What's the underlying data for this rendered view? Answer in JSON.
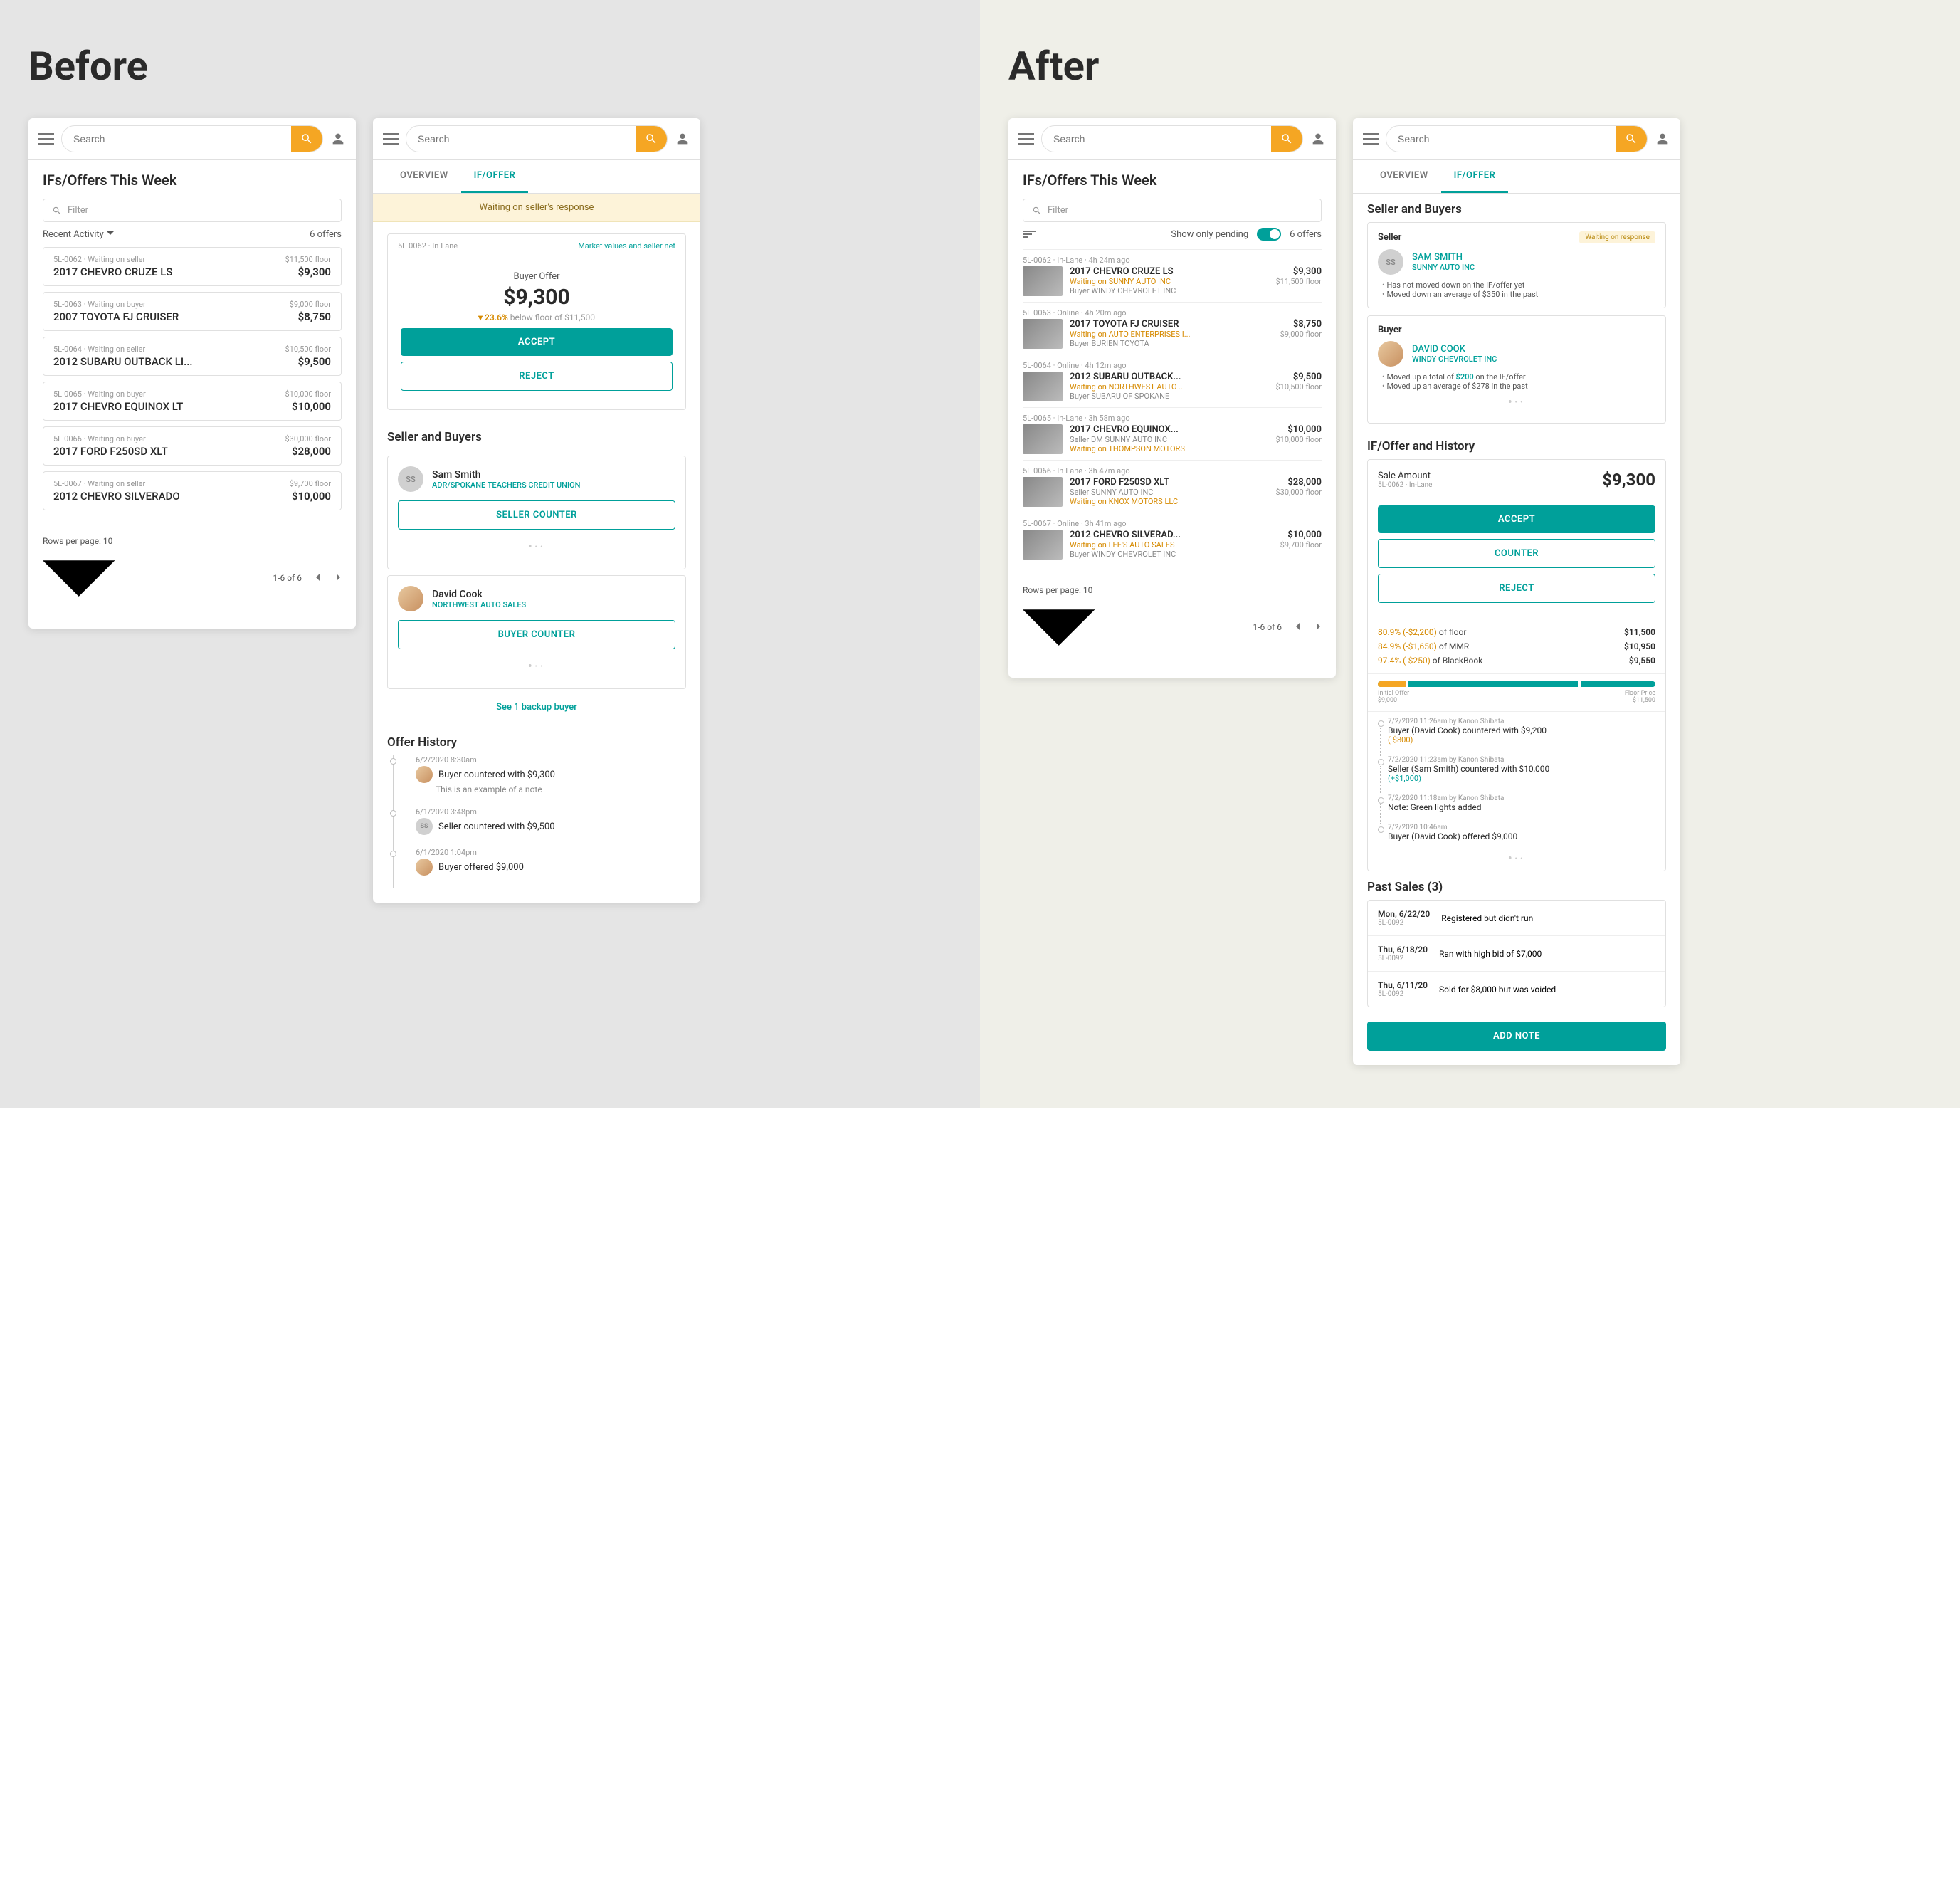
{
  "labels": {
    "before": "Before",
    "after": "After",
    "search_ph": "Search",
    "page_title": "IFs/Offers This Week",
    "filter_ph": "Filter",
    "recent_activity": "Recent Activity",
    "offers_count": "6 offers",
    "rows_per_page": "Rows per page:",
    "rows_value": "10",
    "range": "1-6 of 6",
    "tab_overview": "OVERVIEW",
    "tab_ifoffer": "IF/OFFER",
    "banner": "Waiting on seller's response",
    "market_link": "Market values and seller net",
    "buyer_offer": "Buyer Offer",
    "big_offer": "$9,300",
    "pct_down": "▾ 23.6%",
    "pct_down_rest": " below floor of $11,500",
    "accept": "ACCEPT",
    "reject": "REJECT",
    "counter": "COUNTER",
    "seller_buyers": "Seller and Buyers",
    "seller_counter": "SELLER COUNTER",
    "buyer_counter": "BUYER COUNTER",
    "backup": "See 1 backup buyer",
    "offer_history": "Offer History",
    "show_pending": "Show only pending",
    "seller": "Seller",
    "buyer": "Buyer",
    "waiting_badge": "Waiting on response",
    "ifoffer_history": "IF/Offer and History",
    "sale_amount": "Sale Amount",
    "sale_sub": "5L-0062 · In-Lane",
    "sale_amt": "$9,300",
    "initial_offer": "Initial Offer",
    "initial_val": "$9,000",
    "floor_price": "Floor Price",
    "floor_val": "$11,500",
    "past_sales": "Past Sales (3)",
    "add_note": "ADD NOTE"
  },
  "before_list": [
    {
      "id": "5L-0062",
      "status": "Waiting on seller",
      "floor": "$11,500 floor",
      "name": "2017 CHEVRO CRUZE LS",
      "amt": "$9,300"
    },
    {
      "id": "5L-0063",
      "status": "Waiting on buyer",
      "floor": "$9,000 floor",
      "name": "2007 TOYOTA FJ CRUISER",
      "amt": "$8,750"
    },
    {
      "id": "5L-0064",
      "status": "Waiting on seller",
      "floor": "$10,500 floor",
      "name": "2012 SUBARU OUTBACK LI...",
      "amt": "$9,500"
    },
    {
      "id": "5L-0065",
      "status": "Waiting on buyer",
      "floor": "$10,000 floor",
      "name": "2017 CHEVRO EQUINOX LT",
      "amt": "$10,000"
    },
    {
      "id": "5L-0066",
      "status": "Waiting on buyer",
      "floor": "$30,000 floor",
      "name": "2017 FORD F250SD XLT",
      "amt": "$28,000"
    },
    {
      "id": "5L-0067",
      "status": "Waiting on seller",
      "floor": "$9,700 floor",
      "name": "2012 CHEVRO SILVERADO",
      "amt": "$10,000"
    }
  ],
  "before_people": {
    "seller": {
      "initials": "SS",
      "name": "Sam Smith",
      "org": "ADR/SPOKANE TEACHERS CREDIT UNION"
    },
    "buyer": {
      "name": "David Cook",
      "org": "NORTHWEST AUTO SALES"
    }
  },
  "before_history": [
    {
      "time": "6/2/2020 8:30am",
      "who": "buyer",
      "text": "Buyer countered with $9,300",
      "note": "This is an example of a note"
    },
    {
      "time": "6/1/2020 3:48pm",
      "who": "seller",
      "text": "Seller countered with $9,500"
    },
    {
      "time": "6/1/2020 1:04pm",
      "who": "buyer",
      "text": "Buyer offered $9,000"
    }
  ],
  "after_list": [
    {
      "head": "5L-0062 · In-Lane · 4h 24m ago",
      "name": "2017 CHEVRO CRUZE LS",
      "wait": "Waiting on SUNNY AUTO INC",
      "sub": "Buyer WINDY CHEVROLET INC",
      "amt": "$9,300",
      "floor": "$11,500 floor"
    },
    {
      "head": "5L-0063 · Online · 4h 20m ago",
      "name": "2017 TOYOTA FJ CRUISER",
      "wait": "Waiting on AUTO ENTERPRISES I...",
      "sub": "Buyer BURIEN TOYOTA",
      "amt": "$8,750",
      "floor": "$9,000 floor"
    },
    {
      "head": "5L-0064 · Online · 4h 12m ago",
      "name": "2012 SUBARU OUTBACK...",
      "wait": "Waiting on NORTHWEST AUTO ...",
      "sub": "Buyer SUBARU OF SPOKANE",
      "amt": "$9,500",
      "floor": "$10,500 floor"
    },
    {
      "head": "5L-0065 · In-Lane · 3h 58m ago",
      "name": "2017 CHEVRO EQUINOX...",
      "wait": "",
      "sub": "Seller DM SUNNY AUTO INC",
      "sub2": "Waiting on THOMPSON MOTORS",
      "amt": "$10,000",
      "floor": "$10,000 floor"
    },
    {
      "head": "5L-0066 · In-Lane · 3h 47m ago",
      "name": "2017 FORD F250SD XLT",
      "wait": "",
      "sub": "Seller SUNNY AUTO INC",
      "sub2": "Waiting on KNOX MOTORS LLC",
      "amt": "$28,000",
      "floor": "$30,000 floor"
    },
    {
      "head": "5L-0067 · Online · 3h 41m ago",
      "name": "2012 CHEVRO SILVERAD...",
      "wait": "Waiting on LEE'S AUTO SALES",
      "sub": "Buyer WINDY CHEVROLET INC",
      "amt": "$10,000",
      "floor": "$9,700 floor"
    }
  ],
  "after_seller": {
    "initials": "SS",
    "name": "SAM SMITH",
    "org": "SUNNY AUTO INC",
    "bullets": [
      "Has not moved down on the IF/offer yet",
      "Moved down an average of $350 in the past"
    ]
  },
  "after_buyer": {
    "name": "DAVID COOK",
    "org": "WINDY CHEVROLET INC",
    "bullets_html": [
      {
        "pre": "Moved up a total of ",
        "hl": "$200",
        "post": " on the IF/offer"
      },
      {
        "pre": "Moved up an average of $278 in the past",
        "hl": "",
        "post": ""
      }
    ]
  },
  "pct_rows": [
    {
      "l": "80.9% (-$2,200)",
      "m": "of floor",
      "r": "$11,500"
    },
    {
      "l": "84.9% (-$1,650)",
      "m": "of MMR",
      "r": "$10,950"
    },
    {
      "l": "97.4% (-$250)",
      "m": "of BlackBook",
      "r": "$9,550"
    }
  ],
  "after_history": [
    {
      "time": "7/2/2020 11:26am by Kanon Shibata",
      "text": "Buyer (David Cook) countered with $9,200",
      "delta": "(-$800)",
      "neg": true
    },
    {
      "time": "7/2/2020 11:23am by Kanon Shibata",
      "text": "Seller (Sam Smith) countered with $10,000",
      "delta": "(+$1,000)",
      "neg": false
    },
    {
      "time": "7/2/2020 11:18am by Kanon Shibata",
      "text": "Note: Green lights added"
    },
    {
      "time": "7/2/2020 10:46am",
      "text": "Buyer (David Cook) offered $9,000"
    }
  ],
  "past_sales": [
    {
      "date": "Mon, 6/22/20",
      "id": "5L-0092",
      "desc": "Registered but didn't run"
    },
    {
      "date": "Thu, 6/18/20",
      "id": "5L-0092",
      "desc": "Ran with high bid of $7,000"
    },
    {
      "date": "Thu, 6/11/20",
      "id": "5L-0092",
      "desc": "Sold for $8,000 but was voided"
    }
  ]
}
